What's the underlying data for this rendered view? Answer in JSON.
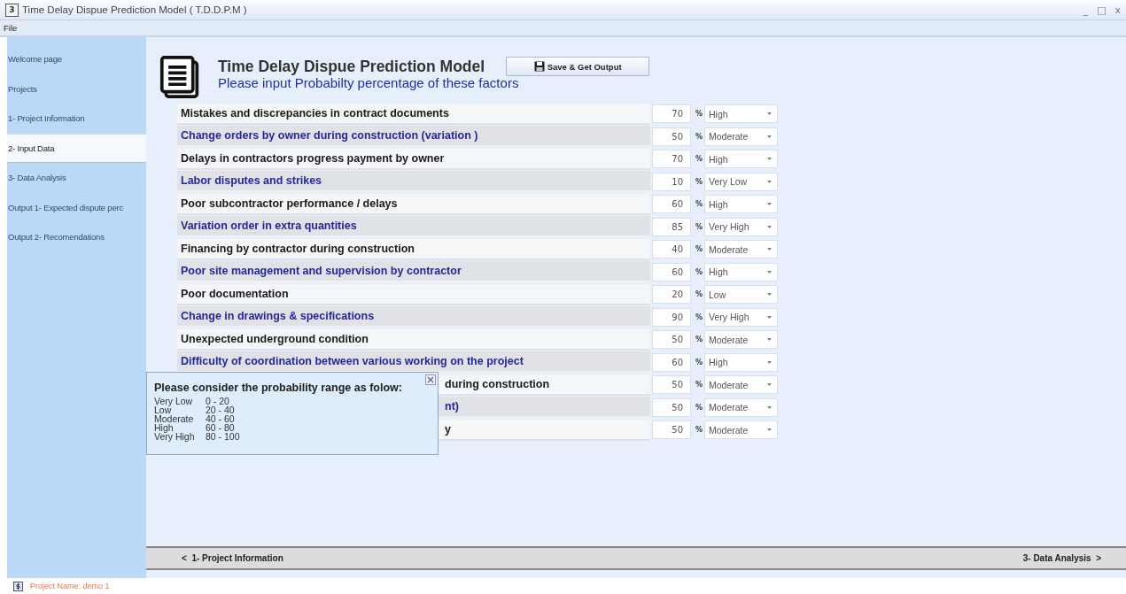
{
  "window": {
    "app_icon": "3",
    "title": "Time Delay Dispue Prediction Model ( T.D.D.P.M )",
    "controls": [
      "_",
      "□",
      "x"
    ]
  },
  "menu": [
    "File"
  ],
  "sidebar": {
    "items": [
      {
        "label": "Welcome page",
        "selected": false
      },
      {
        "label": "Projects",
        "selected": false
      },
      {
        "label": "1- Project Information",
        "selected": false
      },
      {
        "label": "2- Input Data",
        "selected": true
      },
      {
        "label": "3- Data Analysis",
        "selected": false
      },
      {
        "label": "Output 1- Expected dispute perc",
        "selected": false
      },
      {
        "label": "Output 2- Recomendations",
        "selected": false
      }
    ]
  },
  "header": {
    "title": "Time Delay Dispue Prediction Model",
    "save_button": "Save & Get Output",
    "subtitle": "Please input Probabilty percentage of these factors"
  },
  "factors": [
    {
      "label": "Mistakes and discrepancies in contract documents",
      "value": "70",
      "unit": "%",
      "rating": "High",
      "covered": false
    },
    {
      "label": "Change orders by owner during construction (variation )",
      "value": "50",
      "unit": "%",
      "rating": "Moderate",
      "covered": false
    },
    {
      "label": "Delays in contractors progress payment by owner",
      "value": "70",
      "unit": "%",
      "rating": "High",
      "covered": false
    },
    {
      "label": "Labor disputes and strikes",
      "value": "10",
      "unit": "%",
      "rating": "Very Low",
      "covered": false
    },
    {
      "label": "Poor subcontractor performance / delays",
      "value": "60",
      "unit": "%",
      "rating": "High",
      "covered": false
    },
    {
      "label": "Variation order in extra quantities",
      "value": "85",
      "unit": "%",
      "rating": "Very High",
      "covered": false
    },
    {
      "label": "Financing by contractor during construction",
      "value": "40",
      "unit": "%",
      "rating": "Moderate",
      "covered": false
    },
    {
      "label": "Poor site management and supervision by contractor",
      "value": "60",
      "unit": "%",
      "rating": "High",
      "covered": false
    },
    {
      "label": "Poor documentation",
      "value": "20",
      "unit": "%",
      "rating": "Low",
      "covered": false
    },
    {
      "label": "Change in drawings & specifications",
      "value": "90",
      "unit": "%",
      "rating": "Very High",
      "covered": false
    },
    {
      "label": "Unexpected underground condition",
      "value": "50",
      "unit": "%",
      "rating": "Moderate",
      "covered": false
    },
    {
      "label": "Difficulty of coordination between various working on the project",
      "value": "60",
      "unit": "%",
      "rating": "High",
      "covered": false
    },
    {
      "label": "during construction",
      "value": "50",
      "unit": "%",
      "rating": "Moderate",
      "covered": true
    },
    {
      "label": "nt)",
      "value": "50",
      "unit": "%",
      "rating": "Moderate",
      "covered": true
    },
    {
      "label": "y",
      "value": "50",
      "unit": "%",
      "rating": "Moderate",
      "covered": true
    }
  ],
  "popup": {
    "title": "Please consider the probability range as folow:",
    "ranges": [
      {
        "level": "Very Low",
        "range": "0 - 20"
      },
      {
        "level": "Low",
        "range": "20 - 40"
      },
      {
        "level": "Moderate",
        "range": "40 - 60"
      },
      {
        "level": "High",
        "range": "60 - 80"
      },
      {
        "level": "Very High",
        "range": "80 - 100"
      }
    ]
  },
  "navigation": {
    "back": "<  1- Project Information",
    "next": "3- Data Analysis  >"
  },
  "status_bar": {
    "project": "Project Name: demo 1"
  }
}
